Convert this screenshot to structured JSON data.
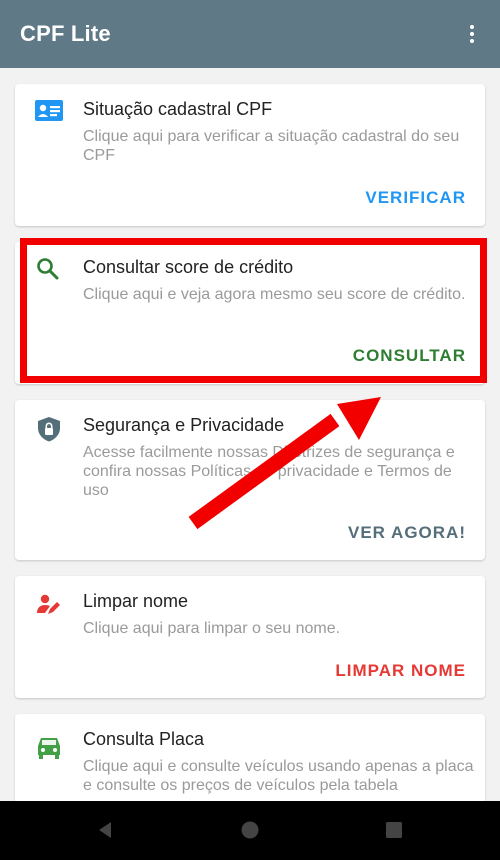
{
  "appbar": {
    "title": "CPF Lite",
    "menu_icon": "more-vert-icon"
  },
  "cards": [
    {
      "title": "Situação cadastral CPF",
      "description": "Clique aqui para verificar a situação cadastral do seu CPF",
      "action": "VERIFICAR",
      "icon": "id-card-icon",
      "accent": "#2196f3"
    },
    {
      "title": "Consultar score de crédito",
      "description": "Clique aqui e veja agora mesmo seu score de crédito.",
      "action": "CONSULTAR",
      "icon": "search-icon",
      "accent": "#2e7d32"
    },
    {
      "title": "Segurança e Privacidade",
      "description": "Acesse facilmente nossas Diretrizes de segurança e confira nossas Políticas de privacidade e Termos de uso",
      "action": "VER AGORA!",
      "icon": "shield-lock-icon",
      "accent": "#546e7a"
    },
    {
      "title": "Limpar nome",
      "description": "Clique aqui para limpar o seu nome.",
      "action": "LIMPAR NOME",
      "icon": "person-edit-icon",
      "accent": "#e53935"
    },
    {
      "title": "Consulta Placa",
      "description": "Clique aqui e consulte veículos usando apenas a placa e consulte os preços de veículos pela tabela",
      "action": "",
      "icon": "car-icon",
      "accent": "#43a047"
    }
  ],
  "annotation": {
    "highlight_color": "#f20000",
    "arrow_color": "#f20000"
  },
  "navbar": {
    "back_icon": "back-triangle-icon",
    "home_icon": "home-circle-icon",
    "recents_icon": "recents-square-icon"
  }
}
